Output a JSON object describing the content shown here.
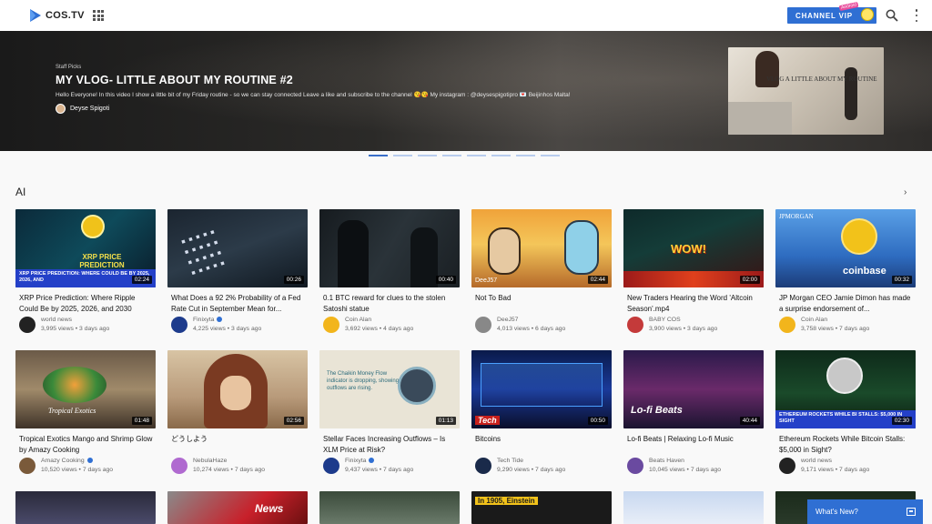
{
  "app": {
    "name": "COS.TV",
    "brand_color": "#2f6fd3"
  },
  "header": {
    "vip_label": "CHANNEL VIP",
    "vip_tag": "Android",
    "icons": [
      "apps-grid-icon",
      "search-icon",
      "more-vert-icon"
    ]
  },
  "hero": {
    "kicker": "Staff Picks",
    "title": "MY VLOG- LITTLE ABOUT MY ROUTINE #2",
    "description": "Hello Everyone! In this video I show a little bit of my Friday routine - so we can stay connected Leave a like and subscribe to the channel 😘😘 My instagram : @deysespigotipro 💌 Beijinhos Malta!",
    "author": "Deyse Spigoti",
    "thumb_text": "VLOG A LITTLE ABOUT MY ROUTINE"
  },
  "carousel": {
    "count": 8,
    "active_index": 0
  },
  "section": {
    "title": "AI",
    "next_icon": "chevron-right-icon"
  },
  "videos": [
    {
      "title": "XRP Price Prediction: Where Ripple Could Be by 2025, 2026, and 2030",
      "duration": "02:24",
      "channel": "world news",
      "stats": "3,995 views • 3 days ago",
      "verified": false
    },
    {
      "title": "What Does a 92 2% Probability of a Fed Rate Cut in September Mean for...",
      "duration": "00:26",
      "channel": "Finixyta",
      "stats": "4,225 views • 3 days ago",
      "verified": true
    },
    {
      "title": "0.1 BTC reward for clues to the stolen Satoshi statue",
      "duration": "00:40",
      "channel": "Coin Alan",
      "stats": "3,692 views • 4 days ago",
      "verified": false
    },
    {
      "title": "Not To Bad",
      "duration": "02:44",
      "channel": "DeeJ57",
      "stats": "4,013 views • 6 days ago",
      "verified": false
    },
    {
      "title": "New Traders Hearing the Word 'Altcoin Season'.mp4",
      "duration": "02:00",
      "channel": "BABY COS",
      "stats": "3,900 views • 3 days ago",
      "verified": false
    },
    {
      "title": "JP Morgan CEO Jamie Dimon has made a surprise endorsement of...",
      "duration": "00:32",
      "channel": "Coin Alan",
      "stats": "3,758 views • 7 days ago",
      "verified": false
    },
    {
      "title": "Tropical Exotics Mango and Shrimp Glow by Amazy Cooking",
      "duration": "01:48",
      "channel": "Amazy Cooking",
      "stats": "10,520 views • 7 days ago",
      "verified": true
    },
    {
      "title": "どうしよう",
      "duration": "02:56",
      "channel": "NebulaHaze",
      "stats": "10,274 views • 7 days ago",
      "verified": false
    },
    {
      "title": "Stellar Faces Increasing Outflows – Is XLM Price at Risk?",
      "duration": "01:13",
      "channel": "Finixyta",
      "stats": "9,437 views • 7 days ago",
      "verified": true
    },
    {
      "title": "Bitcoins",
      "duration": "00:50",
      "channel": "Tech Tide",
      "stats": "9,290 views • 7 days ago",
      "verified": false
    },
    {
      "title": "Lo-fi Beats | Relaxing Lo-fi Music",
      "duration": "40:44",
      "channel": "Beats Haven",
      "stats": "10,045 views • 7 days ago",
      "verified": false
    },
    {
      "title": "Ethereum Rockets While Bitcoin Stalls: $5,000 in Sight?",
      "duration": "02:30",
      "channel": "world news",
      "stats": "9,171 views • 7 days ago",
      "verified": false
    }
  ],
  "thumb_text": {
    "v0": "XRP PRICE PREDICTION: WHERE COULD BE BY 2025, 2026, AND",
    "v0b": "XRP PRICE PREDICTION",
    "v3": "DeeJ57",
    "v4": "WOW!",
    "v5": "coinbase",
    "v5b": "JPMORGAN",
    "v6": "Tropical Exotics",
    "v8": "The Chaikin Money Flow indicator is dropping, showing outflows are rising.",
    "v9": "Tech",
    "v10": "Lo-fi Beats",
    "v11": "ETHEREUM ROCKETS WHILE BI STALLS: $5,000 IN SIGHT",
    "r3a": "In 1905, Einstein",
    "r3b": "News"
  },
  "whats_new": {
    "label": "What's New?"
  }
}
